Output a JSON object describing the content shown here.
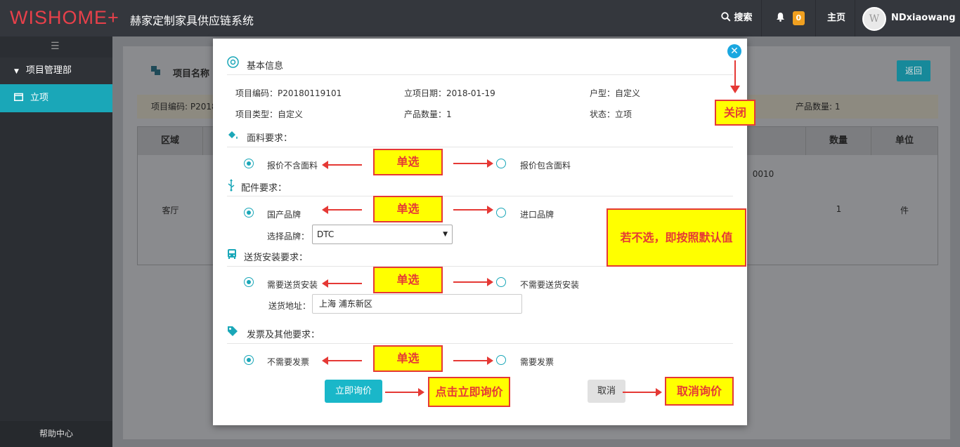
{
  "header": {
    "logo": "WISHOME+",
    "system_title": "赫家定制家具供应链系统",
    "search_label": "搜索",
    "notification_count": "0",
    "home_label": "主页",
    "username": "NDxiaowang"
  },
  "sidebar": {
    "group_label": "项目管理部",
    "active_item": "立项",
    "help_label": "帮助中心"
  },
  "background_page": {
    "title": "项目名称",
    "back_label": "返回",
    "strip_left": "项目编码: P2018",
    "strip_right": "产品数量: 1",
    "table_headers": [
      "区域",
      "数量",
      "单位"
    ],
    "row": {
      "area": "客厅",
      "code_fragment": "0010",
      "qty": "1",
      "unit": "件"
    }
  },
  "modal": {
    "basic_info_title": "基本信息",
    "info": [
      "项目编码：P20180119101",
      "立项日期：2018-01-19",
      "户型：自定义",
      "项目类型：自定义",
      "产品数量：1",
      "状态：立项"
    ],
    "fabric_title": "面料要求：",
    "fabric_opt1": "报价不含面料",
    "fabric_opt2": "报价包含面料",
    "parts_title": "配件要求：",
    "parts_opt1": "国产品牌",
    "parts_opt2": "进口品牌",
    "brand_label": "选择品牌：",
    "brand_value": "DTC",
    "delivery_title": "送货安装要求：",
    "delivery_opt1": "需要送货安装",
    "delivery_opt2": "不需要送货安装",
    "address_label": "送货地址：",
    "address_value": "上海 浦东新区",
    "invoice_title": "发票及其他要求：",
    "invoice_opt1": "不需要发票",
    "invoice_opt2": "需要发票",
    "inquire_label": "立即询价",
    "cancel_label": "取消"
  },
  "annotations": {
    "close": "关闭",
    "single": "单选",
    "default_note": "若不选，即按照默认值",
    "click_inquire": "点击立即询价",
    "cancel_inquire": "取消询价"
  },
  "colors": {
    "accent": "#1aa7b8",
    "logo": "#e8404a",
    "annotation_bg": "#ffff00",
    "annotation_border": "#e53935"
  }
}
